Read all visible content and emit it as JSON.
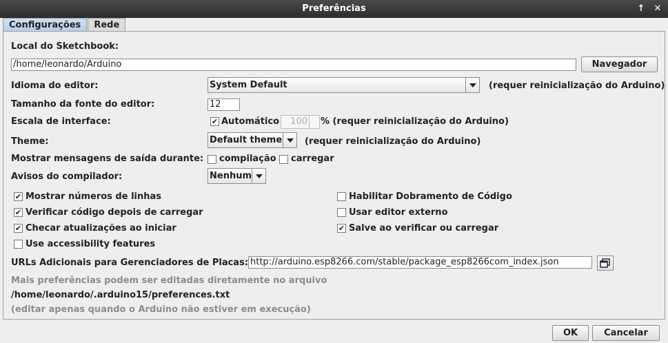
{
  "window": {
    "title": "Preferências",
    "btn_up": "↑",
    "btn_close": "✕"
  },
  "tabs": [
    {
      "label": "Configurações"
    },
    {
      "label": "Rede"
    }
  ],
  "sketchbook": {
    "label": "Local do Sketchbook:",
    "value": "/home/leonardo/Arduino",
    "browse_label": "Navegador"
  },
  "language": {
    "label": "Idioma do editor:",
    "selected": "System Default",
    "note": "(requer reinicialização do Arduino)"
  },
  "font_size": {
    "label": "Tamanho da fonte do editor:",
    "value": "12"
  },
  "scale": {
    "label": "Escala de interface:",
    "auto_label": "Automático",
    "auto_checked": true,
    "value": "100",
    "suffix": "% (requer reinicialização do Arduino)"
  },
  "theme": {
    "label": "Theme:",
    "selected": "Default theme",
    "note": "(requer reinicialização do Arduino)"
  },
  "verbose": {
    "label": "Mostrar mensagens de saída durante:",
    "compile_label": "compilação",
    "upload_label": "carregar"
  },
  "warnings": {
    "label": "Avisos do compilador:",
    "selected": "Nenhum"
  },
  "checkboxes": {
    "line_numbers": {
      "label": "Mostrar números de linhas",
      "checked": true
    },
    "verify_upload": {
      "label": "Verificar código depois de carregar",
      "checked": true
    },
    "check_updates": {
      "label": "Checar atualizações ao iniciar",
      "checked": true
    },
    "accessibility": {
      "label": "Use accessibility features",
      "checked": false
    },
    "code_folding": {
      "label": "Habilitar Dobramento de Código",
      "checked": false
    },
    "external_editor": {
      "label": "Usar editor externo",
      "checked": false
    },
    "save_verify": {
      "label": "Salve ao verificar ou carregar",
      "checked": true
    }
  },
  "boards_url": {
    "label": "URLs Adicionais para Gerenciadores de Placas:",
    "value": "http://arduino.esp8266.com/stable/package_esp8266com_index.json"
  },
  "more_prefs": {
    "text": "Mais preferências podem ser editadas diretamente no arquivo",
    "path": "/home/leonardo/.arduino15/preferences.txt",
    "note": "(editar apenas quando o Arduino não estiver em execução)"
  },
  "footer": {
    "ok_label": "OK",
    "cancel_label": "Cancelar"
  },
  "check_glyph": "✔"
}
